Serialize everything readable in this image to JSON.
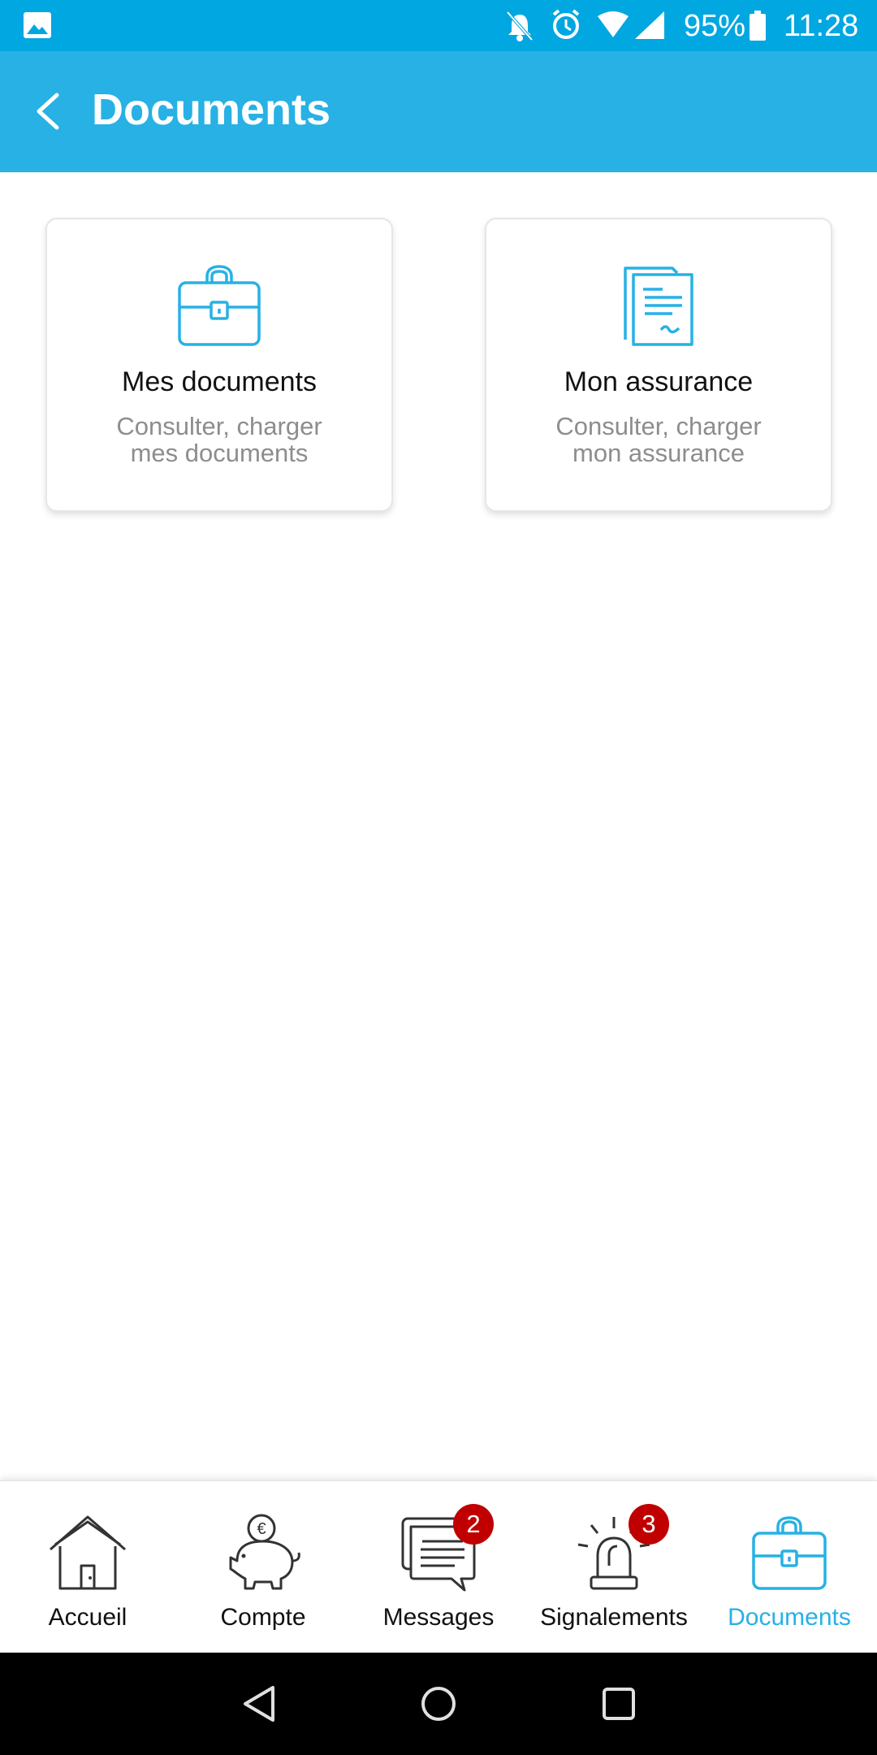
{
  "status_bar": {
    "battery_percent": "95%",
    "time": "11:28",
    "icons": [
      "gallery-icon",
      "bell-off-icon",
      "alarm-icon",
      "wifi-icon",
      "signal-icon",
      "battery-icon"
    ]
  },
  "toolbar": {
    "title": "Documents",
    "back_icon": "chevron-left-icon"
  },
  "cards": [
    {
      "title": "Mes documents",
      "subtitle_line1": "Consulter, charger",
      "subtitle_line2": "mes documents",
      "icon": "briefcase-icon"
    },
    {
      "title": "Mon assurance",
      "subtitle_line1": "Consulter, charger",
      "subtitle_line2": "mon assurance",
      "icon": "document-stack-icon"
    }
  ],
  "bottom_nav": {
    "items": [
      {
        "label": "Accueil",
        "icon": "house-icon",
        "active": false
      },
      {
        "label": "Compte",
        "icon": "piggy-bank-icon",
        "active": false
      },
      {
        "label": "Messages",
        "icon": "message-icon",
        "badge": "2",
        "active": false
      },
      {
        "label": "Signalements",
        "icon": "siren-icon",
        "badge": "3",
        "active": false
      },
      {
        "label": "Documents",
        "icon": "briefcase-icon",
        "active": true
      }
    ]
  },
  "colors": {
    "status_bar": "#00a7e1",
    "toolbar": "#27b1e5",
    "accent": "#27b1e5",
    "badge": "#c00000",
    "subtitle": "#8d8d8d"
  }
}
